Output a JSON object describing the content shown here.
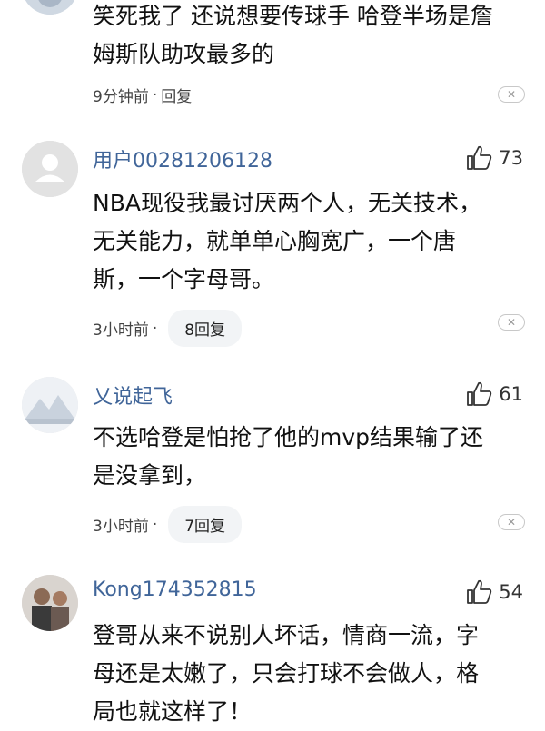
{
  "comments": [
    {
      "text_lines": [
        "笑死我了 还说想要传球手 哈登半场是詹",
        "姆斯队助攻最多的"
      ],
      "time": "9分钟前",
      "reply_label": "回复"
    },
    {
      "username": "用户00281206128",
      "likes": "73",
      "text_lines": [
        "NBA现役我最讨厌两个人，无关技术，",
        "无关能力，就单单心胸宽广，一个唐",
        "斯，一个字母哥。"
      ],
      "time": "3小时前",
      "reply_count": "8回复"
    },
    {
      "username": "乂说起飞",
      "likes": "61",
      "text_lines": [
        "不选哈登是怕抢了他的mvp结果输了还",
        "是没拿到，"
      ],
      "time": "3小时前",
      "reply_count": "7回复"
    },
    {
      "username": "Kong174352815",
      "likes": "54",
      "text_lines": [
        "登哥从来不说别人坏话，情商一流，字",
        "母还是太嫩了，只会打球不会做人，格",
        "局也就这样了！"
      ]
    }
  ],
  "separator": "·",
  "icons": {
    "like": "thumbs-up-icon",
    "close": "close-icon",
    "default_avatar": "person-icon"
  }
}
